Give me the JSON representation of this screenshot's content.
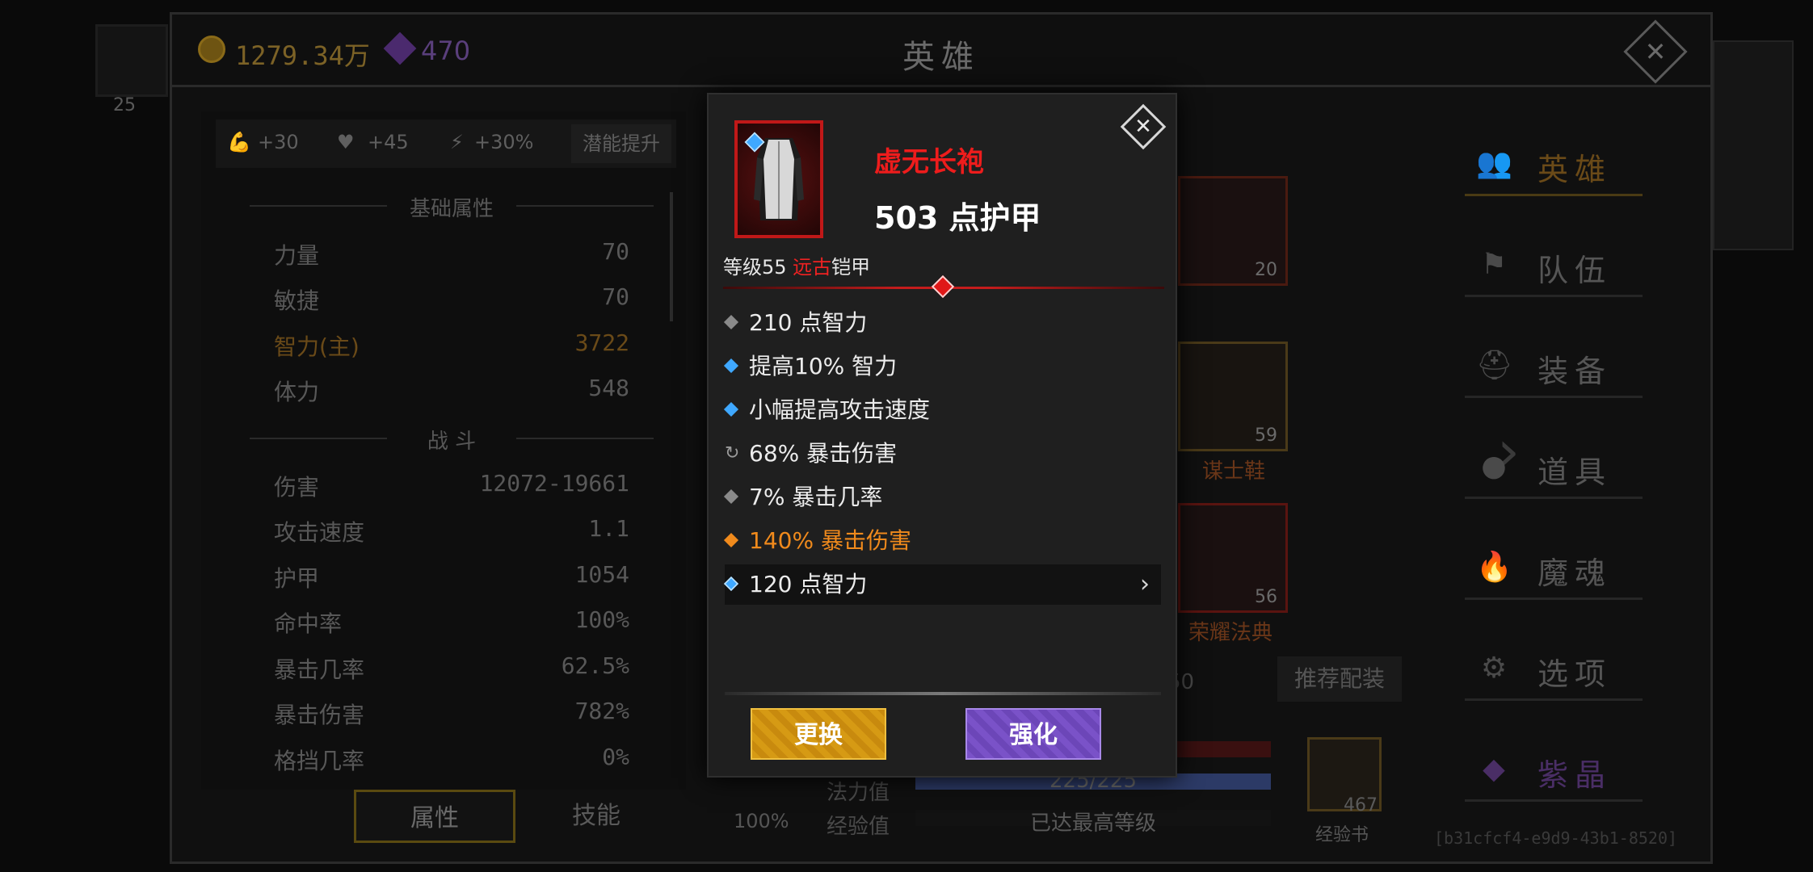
{
  "background": {
    "left_count": "25"
  },
  "topbar": {
    "gold": "1279.34万",
    "gems": "470",
    "title": "英雄"
  },
  "potential": {
    "power": "+30",
    "health": "+45",
    "speed": "+30%",
    "button": "潜能提升"
  },
  "stats": {
    "basic_header": "基础属性",
    "basic": [
      {
        "label": "力量",
        "value": "70"
      },
      {
        "label": "敏捷",
        "value": "70"
      },
      {
        "label": "智力(主)",
        "value": "3722"
      },
      {
        "label": "体力",
        "value": "548"
      }
    ],
    "combat_header": "战 斗",
    "combat": [
      {
        "label": "伤害",
        "value": "12072-19661"
      },
      {
        "label": "攻击速度",
        "value": "1.1"
      },
      {
        "label": "护甲",
        "value": "1054"
      },
      {
        "label": "命中率",
        "value": "100%"
      },
      {
        "label": "暴击几率",
        "value": "62.5%"
      },
      {
        "label": "暴击伤害",
        "value": "782%"
      },
      {
        "label": "格挡几率",
        "value": "0%"
      }
    ]
  },
  "bottom_tabs": {
    "attributes": "属性",
    "skills": "技能"
  },
  "equipment": {
    "slot1_num": "20",
    "slot2_num": "59",
    "slot2_label": "谋士鞋",
    "slot3_num": "56",
    "slot3_label": "荣耀法典",
    "recommend": "推荐配装",
    "hidden_num": "50"
  },
  "bars": {
    "mana_label": "法力值",
    "mana_value": "225/225",
    "xp_label": "经验值",
    "xp_value": "已达最高等级",
    "pct": "100%"
  },
  "book": {
    "count": "467",
    "label": "经验书"
  },
  "nav": [
    {
      "label": "英雄",
      "icon": "hero-icon"
    },
    {
      "label": "队伍",
      "icon": "flag-icon"
    },
    {
      "label": "装备",
      "icon": "helmet-icon"
    },
    {
      "label": "道具",
      "icon": "bag-icon"
    },
    {
      "label": "魔魂",
      "icon": "flame-icon"
    },
    {
      "label": "选项",
      "icon": "gear-icon"
    },
    {
      "label": "紫晶",
      "icon": "crystal-icon"
    }
  ],
  "watermark": "[b31cfcf4-e9d9-43b1-8520]",
  "popup": {
    "name": "虚无长袍",
    "armor": "503 点护甲",
    "level_prefix": "等级55 ",
    "rarity": "远古",
    "type": "铠甲",
    "affixes": [
      {
        "text": "210 点智力",
        "bullet": "#8a8a8a"
      },
      {
        "text": "提高10% 智力",
        "bullet": "#3fa8ff"
      },
      {
        "text": "小幅提高攻击速度",
        "bullet": "#3fa8ff"
      },
      {
        "text": "68% 暴击伤害",
        "bullet": "reroll"
      },
      {
        "text": "7% 暴击几率",
        "bullet": "#8a8a8a"
      },
      {
        "text": "140% 暴击伤害",
        "bullet": "#f08a1c"
      },
      {
        "text": "120 点智力",
        "bullet": "gem"
      }
    ],
    "btn_change": "更换",
    "btn_enhance": "强化"
  },
  "colors": {
    "legendary": "#f08a1c",
    "ancient": "#ee2222",
    "magic": "#3fa8ff"
  }
}
